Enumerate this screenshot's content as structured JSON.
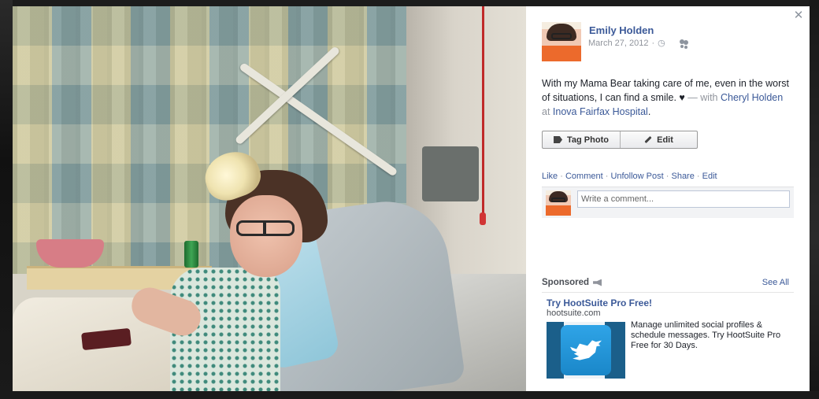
{
  "post": {
    "author": "Emily Holden",
    "date": "March 27, 2012",
    "meta_sep": "·",
    "caption_text": "With my Mama Bear taking care of me, even in the worst of situations, I can find a smile. ♥",
    "with_prefix": "— with",
    "tagged_person": "Cheryl Holden",
    "at_word": "at",
    "place": "Inova Fairfax Hospital",
    "period": "."
  },
  "buttons": {
    "tag_photo": "Tag Photo",
    "edit": "Edit"
  },
  "actions": {
    "like": "Like",
    "comment": "Comment",
    "unfollow": "Unfollow Post",
    "share": "Share",
    "edit": "Edit",
    "sep": " · "
  },
  "comment": {
    "placeholder": "Write a comment..."
  },
  "sponsored": {
    "title": "Sponsored",
    "see_all": "See All",
    "ad_title": "Try HootSuite Pro Free!",
    "ad_domain": "hootsuite.com",
    "ad_body": "Manage unlimited social profiles & schedule messages. Try HootSuite Pro Free for 30 Days."
  },
  "icons": {
    "close": "close-icon",
    "globe": "clock-icon",
    "audience": "friends-icon",
    "tag": "tag-icon",
    "pencil": "pencil-icon",
    "megaphone": "megaphone-icon",
    "twitter": "twitter-bird-icon"
  },
  "colors": {
    "link": "#3b5998",
    "muted": "#90949c",
    "text": "#1d2129",
    "backdrop": "#0b0b0b"
  }
}
